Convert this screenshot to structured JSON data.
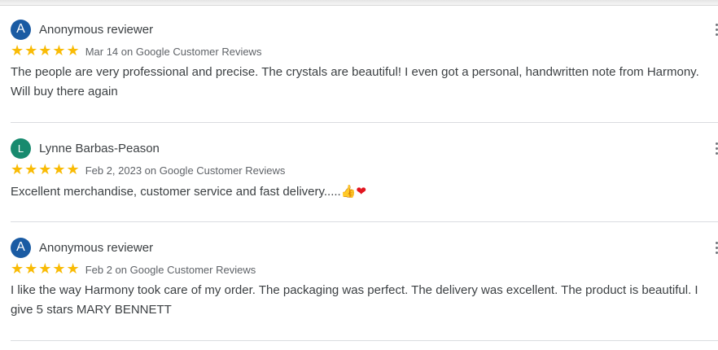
{
  "colors": {
    "avatar_anonymous": "#1a5ba3",
    "avatar_l": "#178a6e",
    "star": "#f9bb05"
  },
  "reviews": [
    {
      "avatar_letter": "A",
      "name": "Anonymous reviewer",
      "stars": "★★★★★",
      "rating": 5,
      "meta": "Mar 14 on Google Customer Reviews",
      "text": "The people are very professional and precise. The crystals are beautiful! I even got a personal, handwritten note from Harmony. Will buy there again"
    },
    {
      "avatar_letter": "L",
      "name": "Lynne Barbas-Peason",
      "stars": "★★★★★",
      "rating": 5,
      "meta": "Feb 2, 2023 on Google Customer Reviews",
      "text": "Excellent merchandise, customer service and fast delivery.....",
      "emoji_thumb": "👍",
      "emoji_heart": "❤"
    },
    {
      "avatar_letter": "A",
      "name": "Anonymous reviewer",
      "stars": "★★★★★",
      "rating": 5,
      "meta": "Feb 2 on Google Customer Reviews",
      "text": "I like the way Harmony took care of my order. The packaging was perfect. The delivery was excellent. The product is beautiful. I give 5 stars MARY BENNETT"
    }
  ]
}
